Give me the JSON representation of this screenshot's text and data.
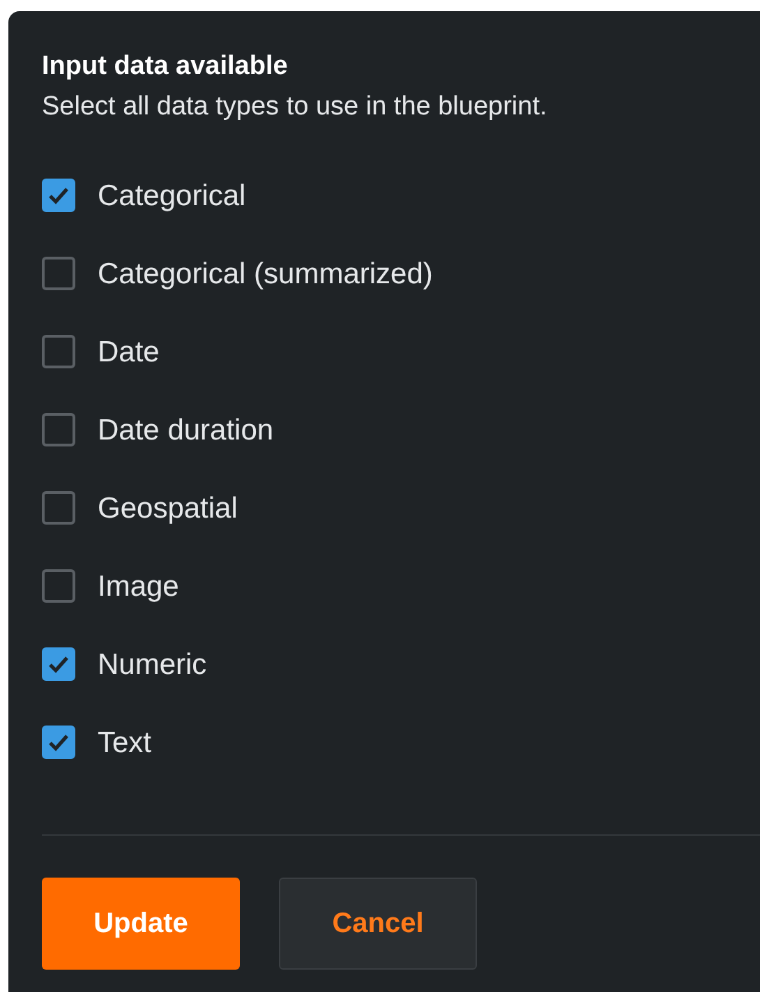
{
  "title": "Input data available",
  "subtitle": "Select all data types to use in the blueprint.",
  "options": [
    {
      "label": "Categorical",
      "checked": true
    },
    {
      "label": "Categorical (summarized)",
      "checked": false
    },
    {
      "label": "Date",
      "checked": false
    },
    {
      "label": "Date duration",
      "checked": false
    },
    {
      "label": "Geospatial",
      "checked": false
    },
    {
      "label": "Image",
      "checked": false
    },
    {
      "label": "Numeric",
      "checked": true
    },
    {
      "label": "Text",
      "checked": true
    }
  ],
  "buttons": [
    {
      "label": "Update",
      "kind": "primary"
    },
    {
      "label": "Cancel",
      "kind": "secondary"
    }
  ]
}
